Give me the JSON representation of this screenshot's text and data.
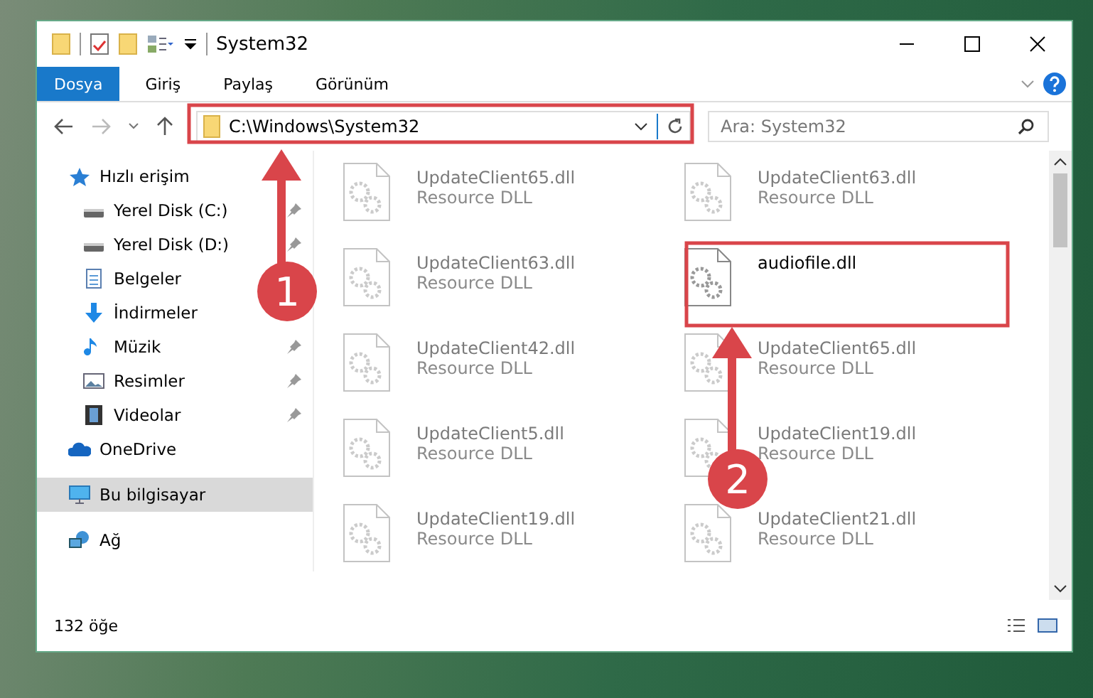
{
  "window": {
    "title": "System32"
  },
  "ribbon_tabs": [
    {
      "label": "Dosya",
      "selected": true
    },
    {
      "label": "Giriş",
      "selected": false
    },
    {
      "label": "Paylaş",
      "selected": false
    },
    {
      "label": "Görünüm",
      "selected": false
    }
  ],
  "address": {
    "path": "C:\\Windows\\System32"
  },
  "search": {
    "placeholder": "Ara: System32"
  },
  "sidebar": {
    "items": [
      {
        "label": "Hızlı erişim",
        "kind": "star",
        "selected": false,
        "children": [
          {
            "label": "Yerel Disk (C:)",
            "kind": "drive",
            "pinned": true,
            "selected": false
          },
          {
            "label": "Yerel Disk (D:)",
            "kind": "drive",
            "pinned": true,
            "selected": false
          },
          {
            "label": "Belgeler",
            "kind": "document",
            "selected": false
          },
          {
            "label": "İndirmeler",
            "kind": "download",
            "selected": false
          },
          {
            "label": "Müzik",
            "kind": "music",
            "pinned": true,
            "selected": false
          },
          {
            "label": "Resimler",
            "kind": "picture",
            "pinned": true,
            "selected": false
          },
          {
            "label": "Videolar",
            "kind": "video",
            "pinned": true,
            "selected": false
          }
        ]
      },
      {
        "label": "OneDrive",
        "kind": "cloud",
        "selected": false
      },
      {
        "label": "Bu bilgisayar",
        "kind": "computer",
        "selected": true
      },
      {
        "label": "Ağ",
        "kind": "network",
        "selected": false
      }
    ]
  },
  "files": [
    {
      "name": "UpdateClient65.dll",
      "type": "Resource DLL",
      "blurred": true
    },
    {
      "name": "UpdateClient63.dll",
      "type": "Resource DLL",
      "blurred": true
    },
    {
      "name": "UpdateClient63.dll",
      "type": "Resource DLL",
      "blurred": true
    },
    {
      "name": "audiofile.dll",
      "blurred": false
    },
    {
      "name": "UpdateClient42.dll",
      "type": "Resource DLL",
      "blurred": true
    },
    {
      "name": "UpdateClient65.dll",
      "type": "Resource DLL",
      "blurred": true
    },
    {
      "name": "UpdateClient5.dll",
      "type": "Resource DLL",
      "blurred": true
    },
    {
      "name": "UpdateClient19.dll",
      "type": "Resource DLL",
      "blurred": true
    },
    {
      "name": "UpdateClient19.dll",
      "type": "Resource DLL",
      "blurred": true
    },
    {
      "name": "UpdateClient21.dll",
      "type": "Resource DLL",
      "blurred": true
    }
  ],
  "annotations": [
    {
      "number": "1"
    },
    {
      "number": "2"
    }
  ],
  "status_bar": {
    "item_count": "132 öğe"
  }
}
